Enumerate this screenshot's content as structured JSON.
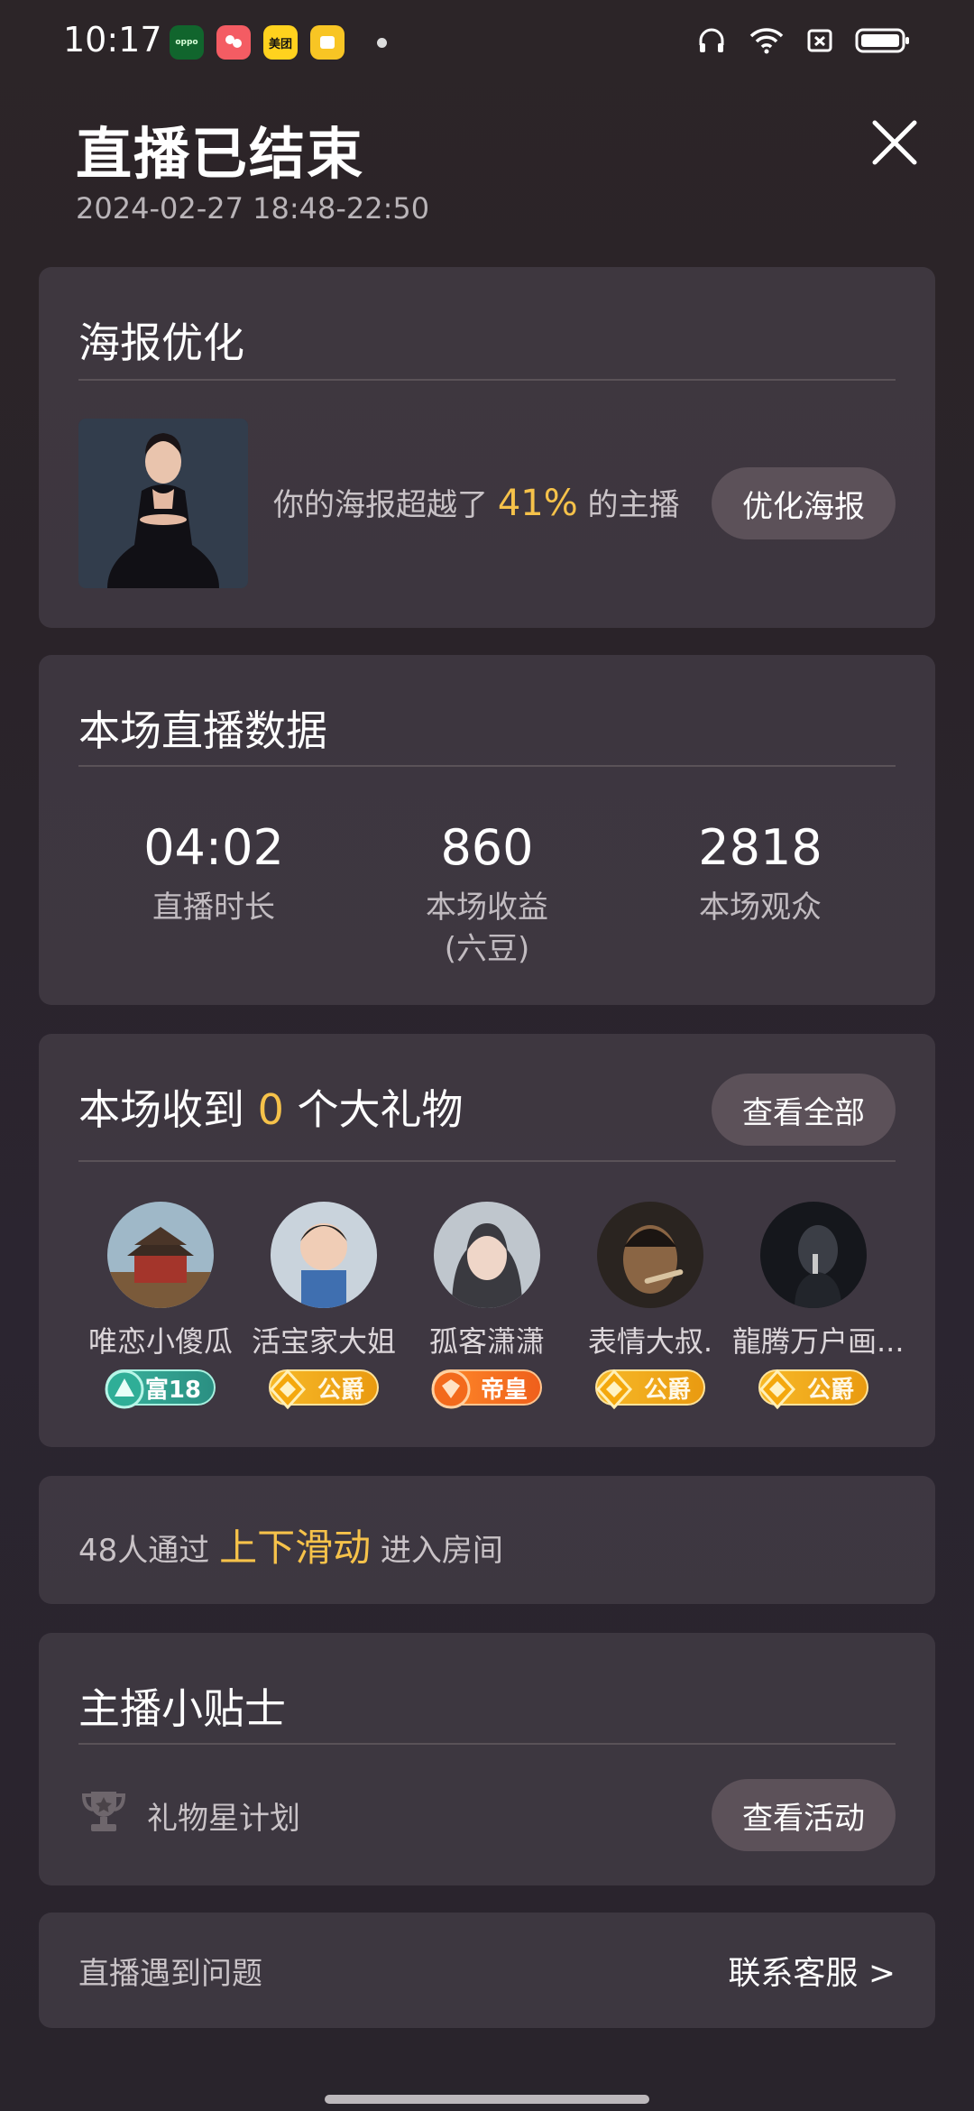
{
  "status_bar": {
    "time": "10:17",
    "app_icons": [
      "oppo",
      "",
      "美团",
      ""
    ],
    "icons": [
      "headphones-icon",
      "wifi-icon",
      "sim-off-icon",
      "battery-icon"
    ]
  },
  "header": {
    "title": "直播已结束",
    "subtitle": "2024-02-27 18:48-22:50"
  },
  "poster_card": {
    "title": "海报优化",
    "text_prefix": "你的海报超越了",
    "percent": "41%",
    "text_suffix": "的主播",
    "button": "优化海报"
  },
  "stats_card": {
    "title": "本场直播数据",
    "stats": [
      {
        "value": "04:02",
        "label": "直播时长",
        "sublabel": ""
      },
      {
        "value": "860",
        "label": "本场收益",
        "sublabel": "(六豆)"
      },
      {
        "value": "2818",
        "label": "本场观众",
        "sublabel": ""
      }
    ]
  },
  "gifts_card": {
    "title_prefix": "本场收到",
    "count": "0",
    "title_suffix": "个大礼物",
    "button": "查看全部",
    "users": [
      {
        "name": "唯恋小傻瓜",
        "badge": "富18",
        "badge_type": "rich"
      },
      {
        "name": "活宝家大姐",
        "badge": "公爵",
        "badge_type": "duke"
      },
      {
        "name": "孤客潇潇",
        "badge": "帝皇",
        "badge_type": "emperor"
      },
      {
        "name": "表情大叔.",
        "badge": "公爵",
        "badge_type": "duke"
      },
      {
        "name": "龍腾万户画...",
        "badge": "公爵",
        "badge_type": "duke"
      }
    ]
  },
  "slide_card": {
    "prefix": "48人通过",
    "highlight": "上下滑动",
    "suffix": "进入房间"
  },
  "tips_card": {
    "title": "主播小贴士",
    "item": "礼物星计划",
    "button": "查看活动"
  },
  "problem_card": {
    "label": "直播遇到问题",
    "link": "联系客服 >"
  },
  "colors": {
    "accent": "#f6c24a",
    "card_bg": "#453e48",
    "pill_bg": "#5c5159"
  }
}
